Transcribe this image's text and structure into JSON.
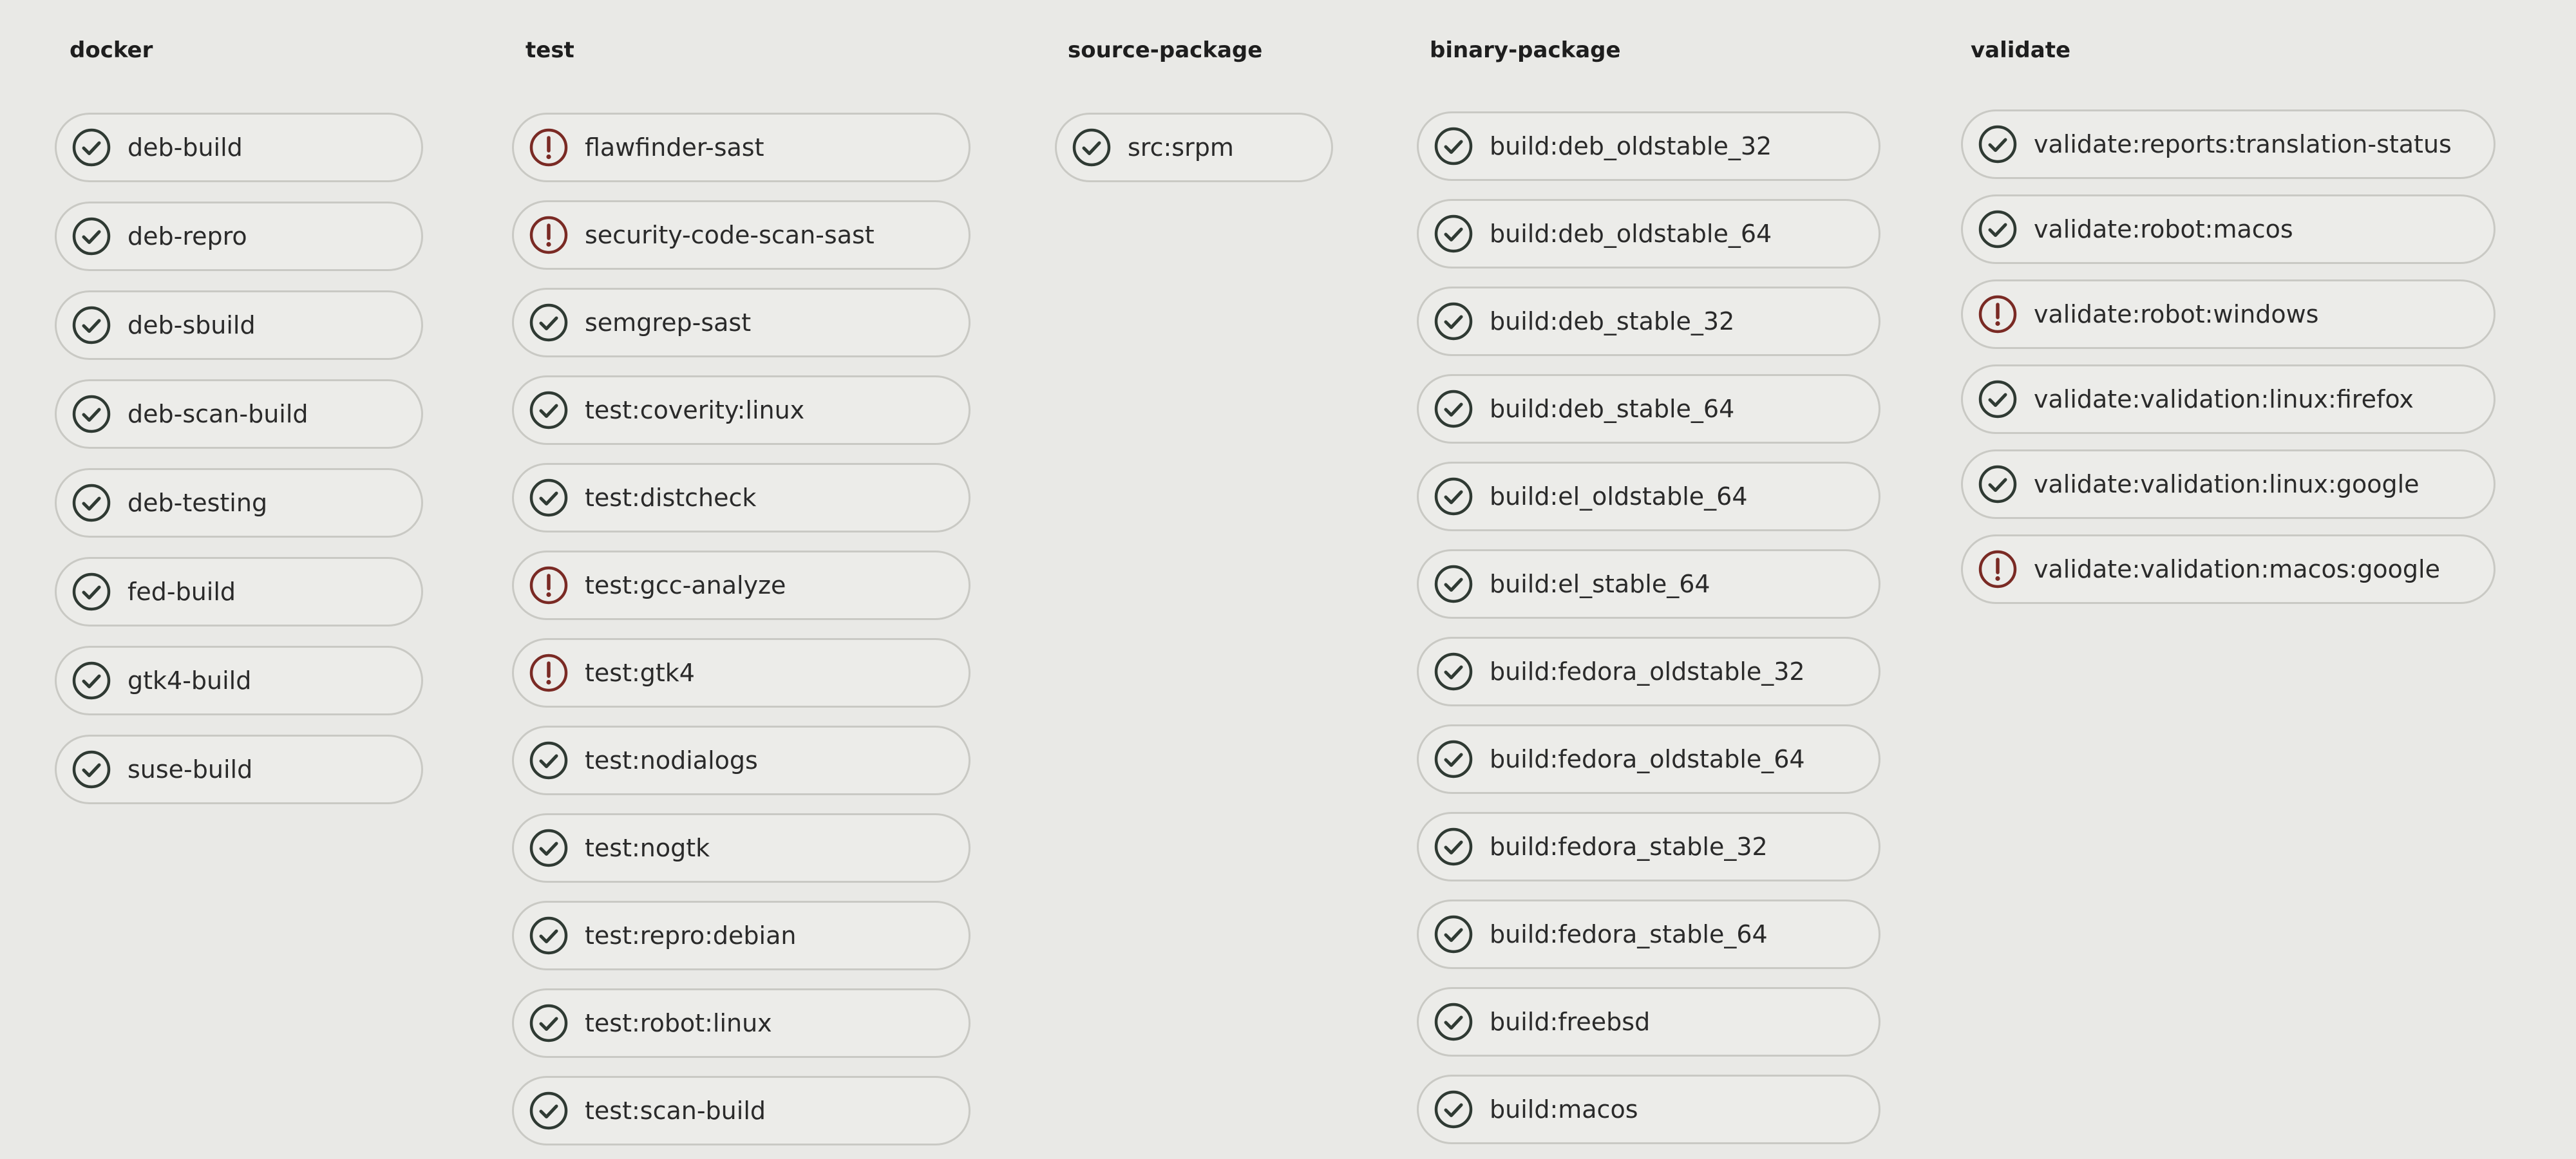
{
  "pipeline": {
    "stages": [
      {
        "name": "docker",
        "jobs": [
          {
            "name": "deb-build",
            "status": "passed"
          },
          {
            "name": "deb-repro",
            "status": "passed"
          },
          {
            "name": "deb-sbuild",
            "status": "passed"
          },
          {
            "name": "deb-scan-build",
            "status": "passed"
          },
          {
            "name": "deb-testing",
            "status": "passed"
          },
          {
            "name": "fed-build",
            "status": "passed"
          },
          {
            "name": "gtk4-build",
            "status": "passed"
          },
          {
            "name": "suse-build",
            "status": "passed"
          }
        ]
      },
      {
        "name": "test",
        "jobs": [
          {
            "name": "flawfinder-sast",
            "status": "warning"
          },
          {
            "name": "security-code-scan-sast",
            "status": "warning"
          },
          {
            "name": "semgrep-sast",
            "status": "passed"
          },
          {
            "name": "test:coverity:linux",
            "status": "passed"
          },
          {
            "name": "test:distcheck",
            "status": "passed"
          },
          {
            "name": "test:gcc-analyze",
            "status": "warning"
          },
          {
            "name": "test:gtk4",
            "status": "warning"
          },
          {
            "name": "test:nodialogs",
            "status": "passed"
          },
          {
            "name": "test:nogtk",
            "status": "passed"
          },
          {
            "name": "test:repro:debian",
            "status": "passed"
          },
          {
            "name": "test:robot:linux",
            "status": "passed"
          },
          {
            "name": "test:scan-build",
            "status": "passed"
          }
        ]
      },
      {
        "name": "source-package",
        "jobs": [
          {
            "name": "src:srpm",
            "status": "passed"
          }
        ]
      },
      {
        "name": "binary-package",
        "jobs": [
          {
            "name": "build:deb_oldstable_32",
            "status": "passed"
          },
          {
            "name": "build:deb_oldstable_64",
            "status": "passed"
          },
          {
            "name": "build:deb_stable_32",
            "status": "passed"
          },
          {
            "name": "build:deb_stable_64",
            "status": "passed"
          },
          {
            "name": "build:el_oldstable_64",
            "status": "passed"
          },
          {
            "name": "build:el_stable_64",
            "status": "passed"
          },
          {
            "name": "build:fedora_oldstable_32",
            "status": "passed"
          },
          {
            "name": "build:fedora_oldstable_64",
            "status": "passed"
          },
          {
            "name": "build:fedora_stable_32",
            "status": "passed"
          },
          {
            "name": "build:fedora_stable_64",
            "status": "passed"
          },
          {
            "name": "build:freebsd",
            "status": "passed"
          },
          {
            "name": "build:macos",
            "status": "passed"
          }
        ]
      },
      {
        "name": "validate",
        "jobs": [
          {
            "name": "validate:reports:translation-status",
            "status": "passed"
          },
          {
            "name": "validate:robot:macos",
            "status": "passed"
          },
          {
            "name": "validate:robot:windows",
            "status": "warning"
          },
          {
            "name": "validate:validation:linux:firefox",
            "status": "passed"
          },
          {
            "name": "validate:validation:linux:google",
            "status": "passed"
          },
          {
            "name": "validate:validation:macos:google",
            "status": "warning"
          }
        ]
      }
    ]
  },
  "colors": {
    "passed": "#2f3a33",
    "warning": "#7a2a24"
  },
  "icons": {
    "passed": "check-circle-icon",
    "warning": "exclamation-circle-icon"
  }
}
